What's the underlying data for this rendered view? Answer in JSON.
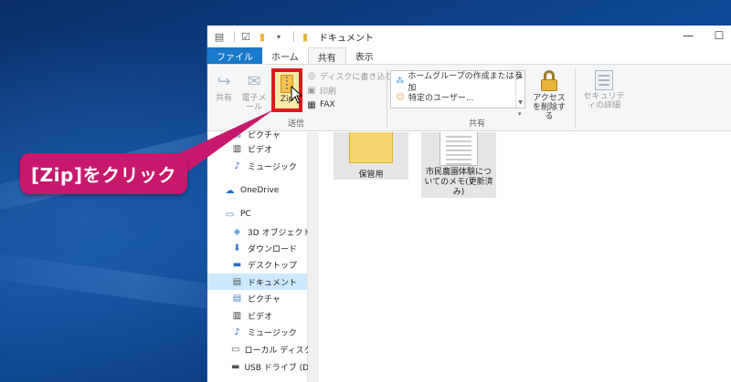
{
  "window": {
    "title": "ドキュメント"
  },
  "tabs": [
    {
      "label": "ファイル"
    },
    {
      "label": "ホーム"
    },
    {
      "label": "共有"
    },
    {
      "label": "表示"
    }
  ],
  "ribbon": {
    "send_group_label": "送信",
    "share_group_label": "共有",
    "share_label": "共有",
    "email_label": "電子メール",
    "zip_label": "Zip",
    "burn_disc_label": "ディスクに書き込む",
    "print_label": "印刷",
    "fax_label": "FAX",
    "share_options": [
      "ホームグループの作成または参加",
      "特定のユーザー..."
    ],
    "stop_sharing_label": "アクセスを削除する",
    "security_label": "セキュリティの詳細"
  },
  "nav": {
    "items": [
      {
        "label": "ピクチャ",
        "icon": "pictures-icon"
      },
      {
        "label": "ビデオ",
        "icon": "video-icon"
      },
      {
        "label": "ミュージック",
        "icon": "music-icon"
      },
      {
        "label": "OneDrive",
        "icon": "onedrive-icon"
      },
      {
        "label": "PC",
        "icon": "pc-icon"
      },
      {
        "label": "3D オブジェクト",
        "icon": "3d-objects-icon"
      },
      {
        "label": "ダウンロード",
        "icon": "download-icon"
      },
      {
        "label": "デスクトップ",
        "icon": "desktop-icon"
      },
      {
        "label": "ドキュメント",
        "icon": "documents-icon"
      },
      {
        "label": "ピクチャ",
        "icon": "pictures-icon"
      },
      {
        "label": "ビデオ",
        "icon": "video-icon"
      },
      {
        "label": "ミュージック",
        "icon": "music-icon"
      },
      {
        "label": "ローカル ディスク (C",
        "icon": "drive-icon"
      },
      {
        "label": "USB ドライブ (D:)",
        "icon": "usb-drive-icon"
      }
    ]
  },
  "files": [
    {
      "name": "保管用",
      "type": "folder"
    },
    {
      "name_lines": [
        "市民農園体験につ",
        "いてのメモ(更新済",
        "み)"
      ],
      "type": "document"
    }
  ],
  "callout": {
    "text": "[Zip]をクリック"
  },
  "colors": {
    "callout": "#c8186c",
    "highlight_border": "#e0181e",
    "file_tab": "#1979ca",
    "selected_nav": "#cce8ff"
  }
}
